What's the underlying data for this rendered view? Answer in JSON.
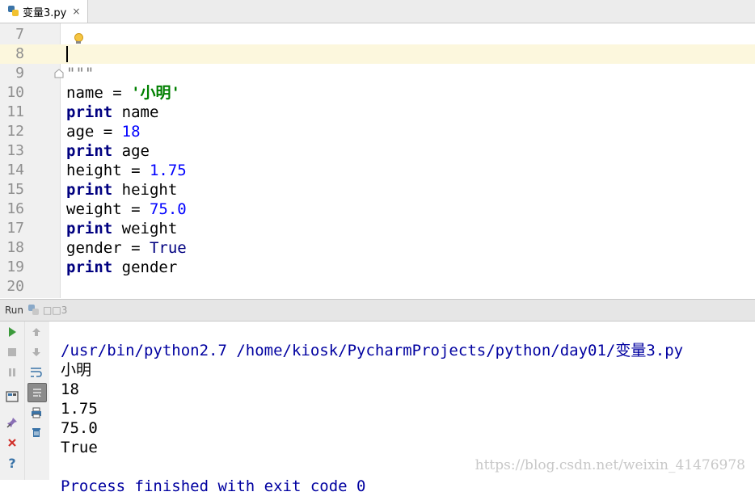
{
  "tab": {
    "filename": "变量3.py",
    "close": "×",
    "icon": "python-file-icon"
  },
  "editor": {
    "line_numbers": [
      "7",
      "8",
      "9",
      "10",
      "11",
      "12",
      "13",
      "14",
      "15",
      "16",
      "17",
      "18",
      "19",
      "20"
    ],
    "line9": "\"\"\"",
    "line10": {
      "var": "name",
      "op": " = ",
      "val": "'小明'"
    },
    "line11": {
      "kw": "print",
      "rest": " name"
    },
    "line12": {
      "var": "age",
      "op": " = ",
      "val": "18"
    },
    "line13": {
      "kw": "print",
      "rest": " age"
    },
    "line14": {
      "var": "height",
      "op": " = ",
      "val": "1.75"
    },
    "line15": {
      "kw": "print",
      "rest": " height"
    },
    "line16": {
      "var": "weight",
      "op": " = ",
      "val": "75.0"
    },
    "line17": {
      "kw": "print",
      "rest": " weight"
    },
    "line18": {
      "var": "gender",
      "op": " = ",
      "val": "True"
    },
    "line19": {
      "kw": "print",
      "rest": " gender"
    },
    "colors": {
      "keyword": "#000080",
      "number": "#0000ff",
      "string": "#008000",
      "current_line": "#fcf7dd"
    }
  },
  "run": {
    "header_label": "Run",
    "config_name": "□□3",
    "output": {
      "command": "/usr/bin/python2.7 /home/kiosk/PycharmProjects/python/day01/变量3.py",
      "lines": [
        "小明",
        "18",
        "1.75",
        "75.0",
        "True"
      ],
      "blank": "",
      "finished": "Process finished with exit code 0"
    },
    "watermark": "https://blog.csdn.net/weixin_41476978"
  }
}
